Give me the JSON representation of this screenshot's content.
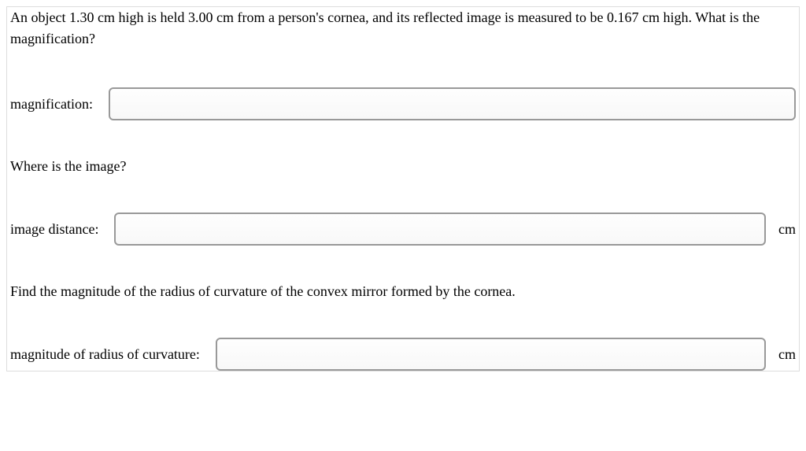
{
  "problem": {
    "statement": "An object 1.30 cm high is held 3.00 cm from a person's cornea, and its reflected image is measured to be 0.167 cm high. What is the magnification?"
  },
  "fields": {
    "magnification": {
      "label": "magnification:",
      "value": "",
      "unit": ""
    },
    "imageDistance": {
      "prompt": "Where is the image?",
      "label": "image distance:",
      "value": "",
      "unit": "cm"
    },
    "radiusOfCurvature": {
      "prompt": "Find the magnitude of the radius of curvature of the convex mirror formed by the cornea.",
      "label": "magnitude of radius of curvature:",
      "value": "",
      "unit": "cm"
    }
  }
}
